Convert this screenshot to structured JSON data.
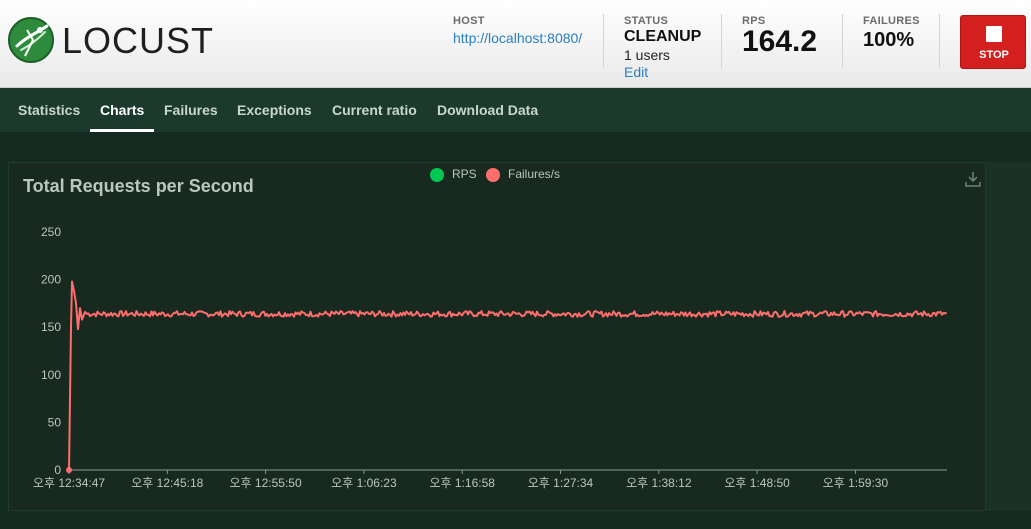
{
  "app": {
    "logo_text": "LOCUST"
  },
  "header": {
    "host": {
      "label": "HOST",
      "value": "http://localhost:8080/"
    },
    "status": {
      "label": "STATUS",
      "value": "CLEANUP",
      "users": "1 users",
      "edit": "Edit"
    },
    "rps": {
      "label": "RPS",
      "value": "164.2"
    },
    "failures": {
      "label": "FAILURES",
      "value": "100%"
    },
    "stop": {
      "label": "STOP"
    }
  },
  "tabs": [
    {
      "label": "Statistics",
      "active": false
    },
    {
      "label": "Charts",
      "active": true
    },
    {
      "label": "Failures",
      "active": false
    },
    {
      "label": "Exceptions",
      "active": false
    },
    {
      "label": "Current ratio",
      "active": false
    },
    {
      "label": "Download Data",
      "active": false
    }
  ],
  "icons": {
    "logo": "locust-logo-icon",
    "stop": "stop-square-icon",
    "download": "download-icon"
  },
  "colors": {
    "rps": "#00c853",
    "failures": "#ff6d6d",
    "stop": "#d41f1f",
    "link": "#2a7fc0"
  },
  "chart_data": {
    "type": "line",
    "title": "Total Requests per Second",
    "legend": [
      "RPS",
      "Failures/s"
    ],
    "legend_position": "top-center",
    "ylim": [
      0,
      250
    ],
    "yticks": [
      0,
      50,
      100,
      150,
      200,
      250
    ],
    "xticks": [
      "오후 12:34:47",
      "오후 12:45:18",
      "오후 12:55:50",
      "오후 1:06:23",
      "오후 1:16:58",
      "오후 1:27:34",
      "오후 1:38:12",
      "오후 1:48:50",
      "오후 1:59:30"
    ],
    "grid": false,
    "series": [
      {
        "name": "Failures/s",
        "color": "#ff6d6d",
        "description_values": {
          "start": 0,
          "peak": 198,
          "steady_state": 164
        },
        "points": [
          {
            "t": "오후 12:34:47",
            "v": 0
          },
          {
            "t": "오후 12:34:55",
            "v": 150
          },
          {
            "t": "오후 12:35:05",
            "v": 198
          },
          {
            "t": "오후 12:35:20",
            "v": 180
          },
          {
            "t": "오후 12:35:40",
            "v": 150
          },
          {
            "t": "오후 12:36:10",
            "v": 165
          },
          {
            "t": "오후 12:45:18",
            "v": 164
          },
          {
            "t": "오후 12:55:50",
            "v": 164
          },
          {
            "t": "오후 1:06:23",
            "v": 164
          },
          {
            "t": "오후 1:16:58",
            "v": 164
          },
          {
            "t": "오후 1:27:34",
            "v": 164
          },
          {
            "t": "오후 1:38:12",
            "v": 164
          },
          {
            "t": "오후 1:48:50",
            "v": 164
          },
          {
            "t": "오후 1:59:30",
            "v": 164
          },
          {
            "t": "end",
            "v": 164
          }
        ]
      },
      {
        "name": "RPS",
        "color": "#00c853",
        "note_hidden_under_failures": true,
        "points": []
      }
    ]
  }
}
